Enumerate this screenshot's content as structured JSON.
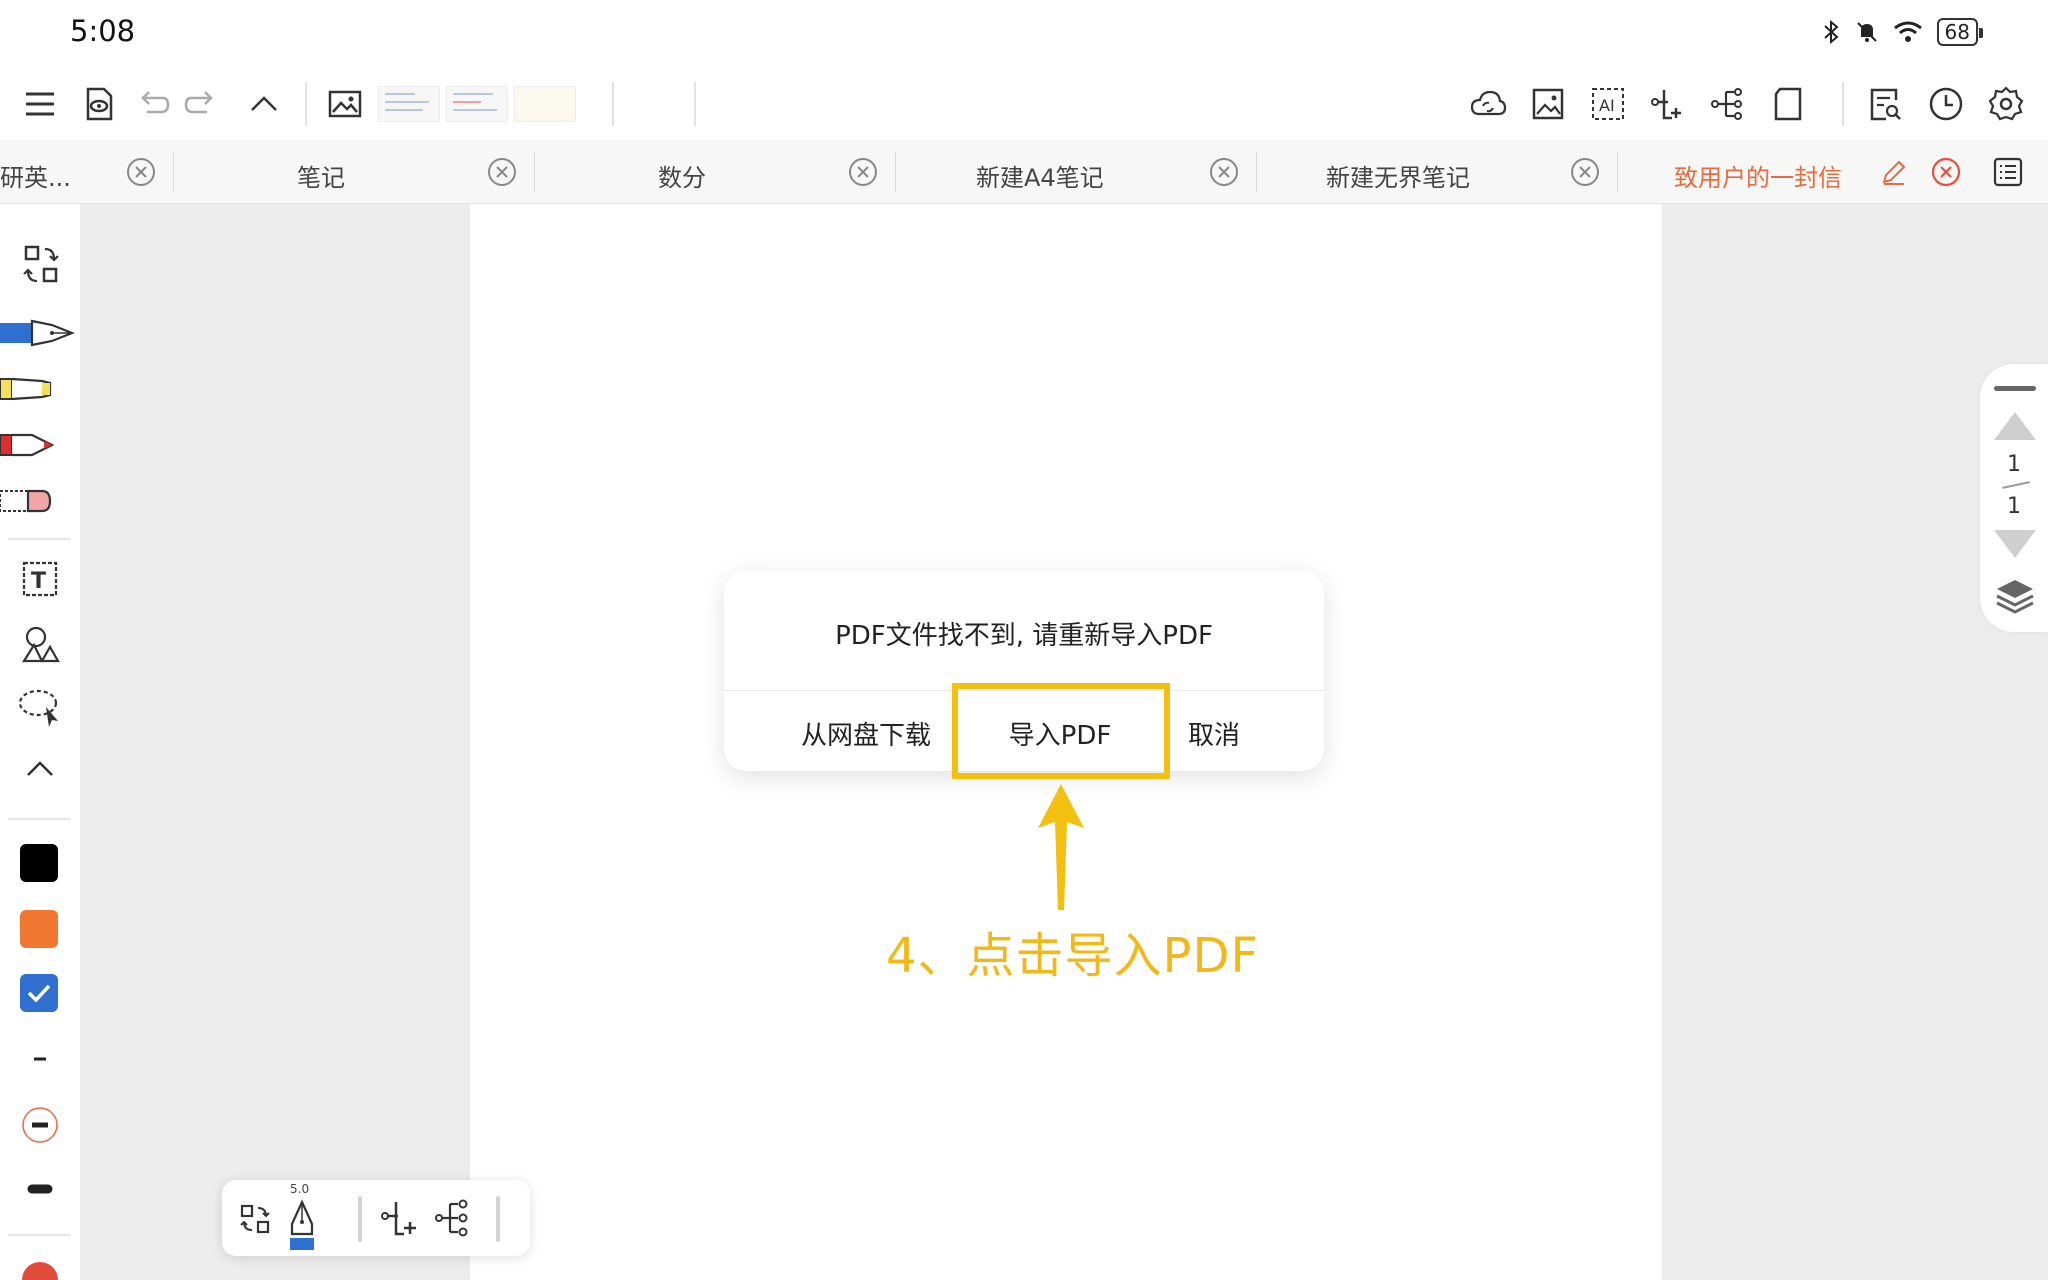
{
  "status_bar": {
    "time": "5:08",
    "battery": "68",
    "icons": [
      "bluetooth-icon",
      "mute-icon",
      "wifi-icon",
      "battery-icon"
    ]
  },
  "toolbar": {
    "left_icons": [
      "menu-icon",
      "preview-icon",
      "undo-icon",
      "redo-icon",
      "collapse-icon",
      "image-icon"
    ],
    "right_icons": [
      "cloud-sync-icon",
      "insert-image-icon",
      "ai-icon",
      "mindmap-add-icon",
      "mindmap-icon",
      "page-icon",
      "search-doc-icon",
      "history-icon",
      "settings-icon"
    ]
  },
  "tabs": [
    {
      "label": "研英..."
    },
    {
      "label": "笔记"
    },
    {
      "label": "数分"
    },
    {
      "label": "新建A4笔记"
    },
    {
      "label": "新建无界笔记"
    },
    {
      "label": "致用户的一封信",
      "active": true
    }
  ],
  "left_tools": {
    "colors": [
      "#000000",
      "#f07830",
      "#2f6fd0"
    ]
  },
  "page_nav": {
    "current": "1",
    "total": "1"
  },
  "dialog": {
    "message": "PDF文件找不到, 请重新导入PDF",
    "buttons": {
      "download": "从网盘下载",
      "import": "导入PDF",
      "cancel": "取消"
    }
  },
  "annotation": {
    "text": "4、点击导入PDF",
    "color": "#f4b816"
  },
  "bottom_float": {
    "pen_size": "5.0"
  },
  "colors": {
    "accent": "#e86b3d",
    "highlight": "#f4c010"
  }
}
